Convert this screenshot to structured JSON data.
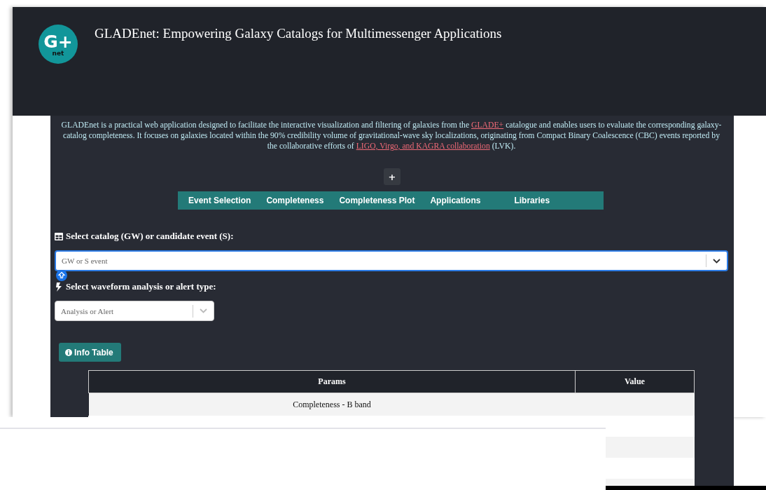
{
  "header": {
    "logo": {
      "mark": "G+",
      "sub": "net"
    },
    "title": "GLADEnet: Empowering Galaxy Catalogs for Multimessenger Applications"
  },
  "intro": [
    {
      "kind": "text",
      "text": "GLADEnet is a practical web application designed to facilitate the interactive visualization and filtering of galaxies from the "
    },
    {
      "kind": "link",
      "text": "GLADE+"
    },
    {
      "kind": "text",
      "text": " catalogue and enables users to evaluate the corresponding galaxy-catalog completeness. It focuses on galaxies located within the 90% credibility volume of gravitational-wave sky localizations, originating from Compact Binary Coalescence (CBC) events reported by the collaborative efforts of "
    },
    {
      "kind": "link",
      "text": "LIGO, Virgo, and KAGRA collaboration"
    },
    {
      "kind": "text",
      "text": " (LVK)."
    }
  ],
  "expand_button": "+",
  "nav": [
    {
      "label": "Event Selection"
    },
    {
      "label": "Completeness"
    },
    {
      "label": "Completeness Plot"
    },
    {
      "label": "Applications"
    },
    {
      "label": "Libraries"
    }
  ],
  "fields": [
    {
      "label": "Select catalog (GW) or candidate event (S):",
      "placeholder": "GW or S event",
      "kind": "wide",
      "focused": true
    },
    {
      "label": "Select waveform analysis or alert type:",
      "placeholder": "Analysis or Alert",
      "kind": "compact",
      "focused": false
    }
  ],
  "info_button": "Info Table",
  "table": {
    "columns": [
      "Params",
      "Value"
    ],
    "rows": [
      {
        "params": "Completeness - B band"
      }
    ]
  }
}
